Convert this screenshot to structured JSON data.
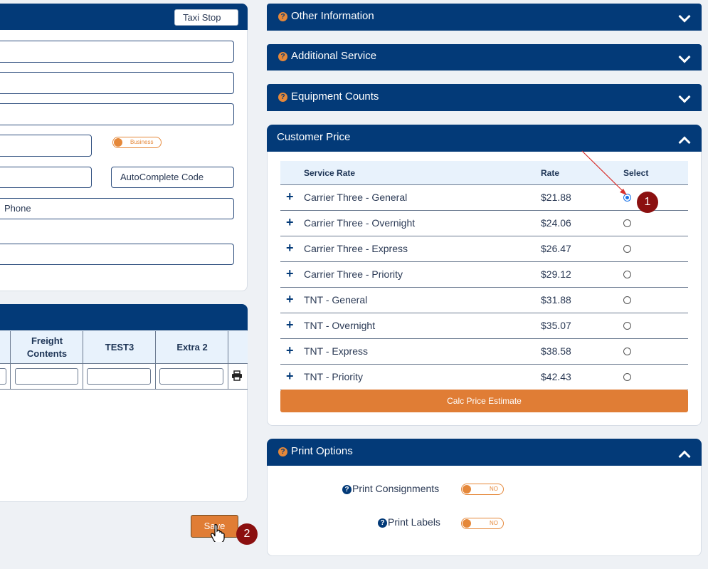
{
  "left_form": {
    "taxi_stop_value": "Taxi Stop",
    "business_toggle_label": "Business",
    "autocomplete_placeholder": "AutoComplete Code",
    "phone_placeholder": "Phone"
  },
  "freight_grid": {
    "columns": [
      "Freight Contents",
      "TEST3",
      "Extra 2"
    ]
  },
  "save_button": "Save",
  "sections": {
    "other_information": "Other Information",
    "additional_service": "Additional Service",
    "equipment_counts": "Equipment Counts",
    "customer_price": "Customer Price",
    "print_options": "Print Options"
  },
  "customer_price": {
    "headers": {
      "service": "Service Rate",
      "rate": "Rate",
      "select": "Select"
    },
    "rows": [
      {
        "name": "Carrier Three - General",
        "rate": "$21.88",
        "selected": true
      },
      {
        "name": "Carrier Three - Overnight",
        "rate": "$24.06",
        "selected": false
      },
      {
        "name": "Carrier Three - Express",
        "rate": "$26.47",
        "selected": false
      },
      {
        "name": "Carrier Three - Priority",
        "rate": "$29.12",
        "selected": false
      },
      {
        "name": "TNT - General",
        "rate": "$31.88",
        "selected": false
      },
      {
        "name": "TNT - Overnight",
        "rate": "$35.07",
        "selected": false
      },
      {
        "name": "TNT - Express",
        "rate": "$38.58",
        "selected": false
      },
      {
        "name": "TNT - Priority",
        "rate": "$42.43",
        "selected": false
      }
    ],
    "calc_button": "Calc Price Estimate"
  },
  "print_options": {
    "print_consignments": "Print Consignments",
    "print_labels": "Print Labels",
    "consignments_toggle": "NO",
    "labels_toggle": "NO"
  },
  "annotations": {
    "badge_1": "1",
    "badge_2": "2"
  },
  "colors": {
    "navy": "#033a78",
    "orange": "#e5883a",
    "marker": "#8b1010"
  }
}
